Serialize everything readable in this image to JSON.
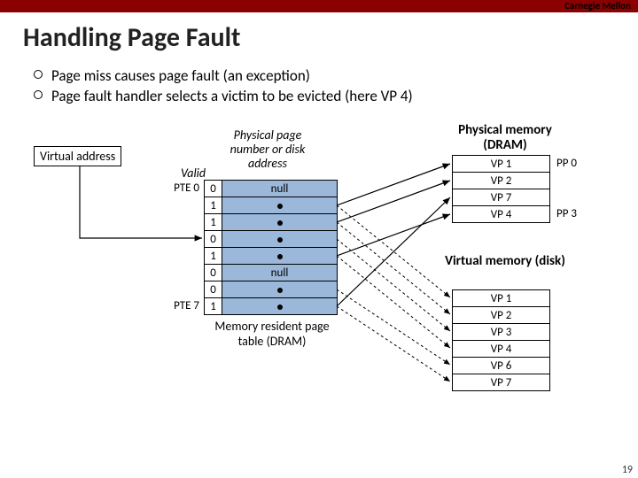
{
  "header": {
    "institution": "Carnegie Mellon",
    "title": "Handling Page Fault"
  },
  "bullets": [
    "Page miss causes page fault (an exception)",
    "Page fault handler selects a victim to be evicted (here VP 4)"
  ],
  "labels": {
    "virtual_address": "Virtual address",
    "ppn_header": "Physical page number or disk address",
    "valid": "Valid",
    "pte0": "PTE 0",
    "pte7": "PTE 7",
    "mem_resident": "Memory resident page table (DRAM)",
    "phys_mem": "Physical memory (DRAM)",
    "virt_mem": "Virtual memory (disk)",
    "pp0": "PP 0",
    "pp3": "PP 3"
  },
  "page_table": {
    "rows": [
      {
        "valid": "0",
        "addr": "null"
      },
      {
        "valid": "1",
        "addr": ""
      },
      {
        "valid": "1",
        "addr": ""
      },
      {
        "valid": "0",
        "addr": ""
      },
      {
        "valid": "1",
        "addr": ""
      },
      {
        "valid": "0",
        "addr": "null"
      },
      {
        "valid": "0",
        "addr": ""
      },
      {
        "valid": "1",
        "addr": ""
      }
    ]
  },
  "phys_mem": [
    "VP 1",
    "VP 2",
    "VP 7",
    "VP 4"
  ],
  "virt_mem": [
    "VP 1",
    "VP 2",
    "VP 3",
    "VP 4",
    "VP 6",
    "VP 7"
  ],
  "page_number": "19"
}
